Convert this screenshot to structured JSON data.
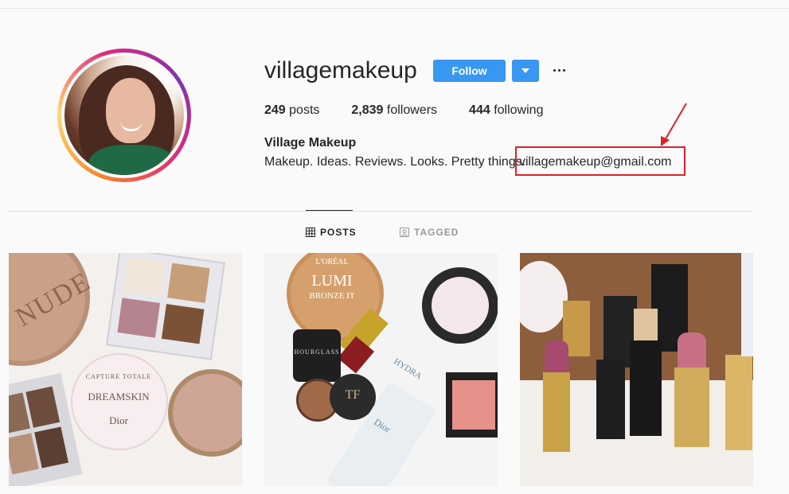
{
  "profile": {
    "username": "villagemakeup",
    "follow_label": "Follow",
    "posts_count": "249",
    "posts_label": "posts",
    "followers_count": "2,839",
    "followers_label": "followers",
    "following_count": "444",
    "following_label": "following",
    "full_name": "Village Makeup",
    "bio": "Makeup. Ideas. Reviews. Looks. Pretty things.",
    "email": "villagemakeup@gmail.com"
  },
  "tabs": [
    {
      "label": "POSTS",
      "icon": "grid-icon",
      "active": true
    },
    {
      "label": "TAGGED",
      "icon": "tagged-icon",
      "active": false
    }
  ],
  "posts": [
    {
      "texts": [
        "NUDE",
        "CAPTURE TOTALE",
        "DREAMSKIN",
        "Dior"
      ]
    },
    {
      "texts": [
        "L'ORÉAL",
        "LUMI",
        "BRONZE IT",
        "HOURGLASS",
        "TF",
        "HYDRA",
        "Dior"
      ]
    },
    {
      "texts": []
    }
  ],
  "colors": {
    "accent": "#3897f0",
    "annotation": "#e0202a"
  }
}
